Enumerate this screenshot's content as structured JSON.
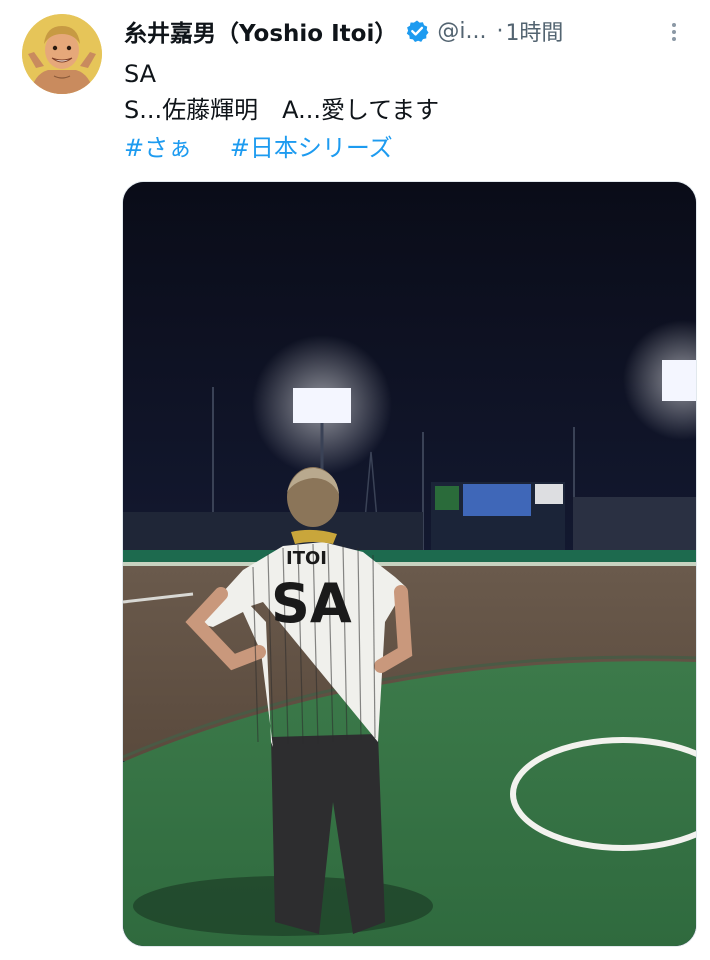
{
  "tweet": {
    "author": {
      "display_name": "糸井嘉男（Yoshio Itoi）",
      "handle": "@i...",
      "verified": true,
      "avatar_icon": "cartoon-avatar"
    },
    "separator": "·",
    "time": "1時間",
    "text_lines": [
      "SA",
      "S...佐藤輝明　A...愛してます"
    ],
    "hashtags": [
      "#さぁ",
      "#日本シリーズ"
    ],
    "media": {
      "photo_text": {
        "jersey_name": "ITOI",
        "jersey_letters": "SA"
      }
    }
  },
  "colors": {
    "link": "#1d9bf0",
    "text": "#0f1419",
    "secondary": "#536471",
    "verified": "#1d9bf0"
  },
  "icons": {
    "verified": "verified-badge-icon",
    "more": "more-vertical-icon"
  }
}
